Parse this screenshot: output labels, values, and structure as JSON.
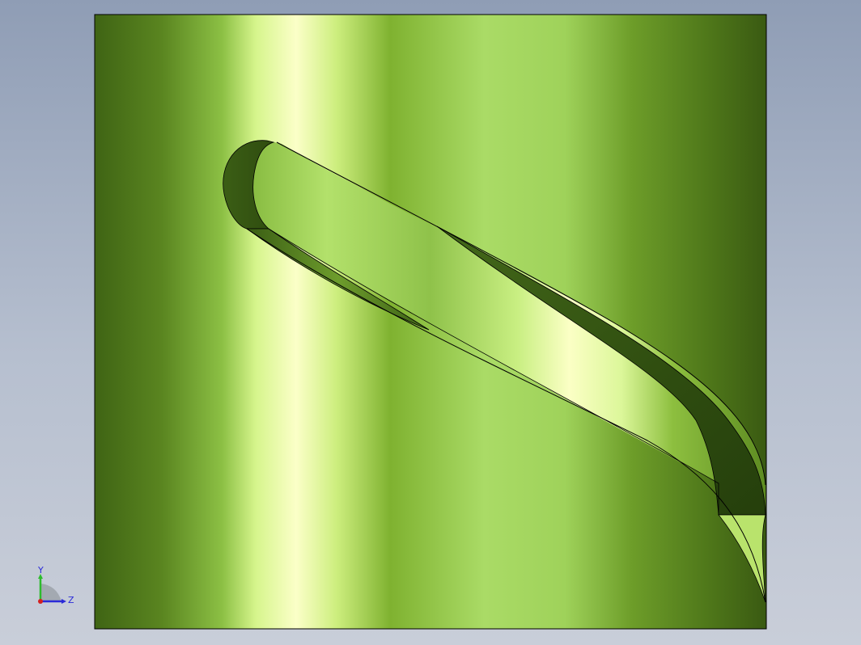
{
  "viewport": {
    "background_top": "#8f9db5",
    "background_bottom": "#c9ced9"
  },
  "model": {
    "description_color_dark": "#3f6414",
    "description_color_light": "#fbffc8",
    "edge_color": "#000000"
  },
  "triad": {
    "y_label": "Y",
    "z_label": "Z",
    "y_color": "#2dbb2d",
    "z_color": "#2a2ad8",
    "x_color": "#d42020"
  }
}
